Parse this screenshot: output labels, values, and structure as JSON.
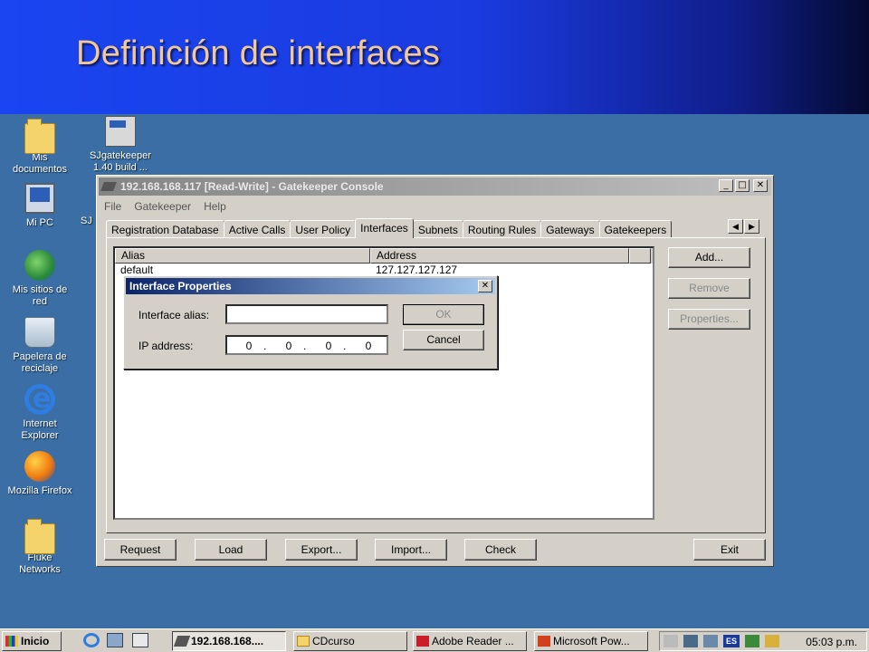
{
  "slide": {
    "title": "Definición de interfaces"
  },
  "desktop_icons": [
    {
      "label": "Mis\ndocumentos",
      "icon": "folder-icon"
    },
    {
      "label": "Mi PC",
      "icon": "computer-icon"
    },
    {
      "label": "Mis sitios de\nred",
      "icon": "network-places-icon"
    },
    {
      "label": "Papelera de\nreciclaje",
      "icon": "recycle-bin-icon"
    },
    {
      "label": "Internet\nExplorer",
      "icon": "internet-explorer-icon"
    },
    {
      "label": "Mozilla Firefox",
      "icon": "firefox-icon"
    },
    {
      "label": "Fluke\nNetworks",
      "icon": "folder-icon"
    },
    {
      "label": "SJgatekeeper\n1.40 build ...",
      "icon": "gatekeeper-app-icon"
    },
    {
      "label": "SJ",
      "icon": ""
    }
  ],
  "window": {
    "title": "192.168.168.117 [Read-Write] - Gatekeeper Console",
    "menu": [
      "File",
      "Gatekeeper",
      "Help"
    ],
    "tabs": [
      "Registration Database",
      "Active Calls",
      "User Policy",
      "Interfaces",
      "Subnets",
      "Routing Rules",
      "Gateways",
      "Gatekeepers"
    ],
    "active_tab": "Interfaces",
    "list": {
      "columns": [
        "Alias",
        "Address"
      ],
      "rows": [
        {
          "alias": "default",
          "address": "127.127.127.127"
        }
      ]
    },
    "side_buttons": {
      "add": "Add...",
      "remove": "Remove",
      "properties": "Properties..."
    },
    "bottom_buttons": {
      "request": "Request",
      "load": "Load",
      "export": "Export...",
      "import": "Import...",
      "check": "Check",
      "exit": "Exit"
    }
  },
  "dialog": {
    "title": "Interface Properties",
    "alias_label": "Interface alias:",
    "alias_value": "",
    "ip_label": "IP address:",
    "ip_octets": [
      "0",
      "0",
      "0",
      "0"
    ],
    "ip_dot": ".",
    "ok": "OK",
    "cancel": "Cancel"
  },
  "taskbar": {
    "start": "Inicio",
    "tasks": [
      "192.168.168....",
      "CDcurso",
      "Adobe Reader ...",
      "Microsoft Pow..."
    ],
    "tray_lang": "ES",
    "clock": "05:03 p.m."
  }
}
